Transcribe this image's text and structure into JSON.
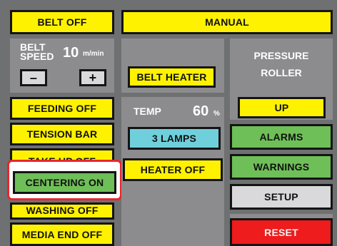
{
  "header": {
    "belt_button": "BELT OFF",
    "mode_button": "MANUAL"
  },
  "belt_speed": {
    "label_line1": "BELT",
    "label_line2": "SPEED",
    "value": "10",
    "unit": "m/min",
    "minus_label": "–",
    "plus_label": "+"
  },
  "left_column": {
    "feeding": "FEEDING OFF",
    "tension_bar": "TENSION BAR",
    "take_up": "TAKE UP OFF",
    "centering": "CENTERING ON",
    "washing": "WASHING OFF",
    "media_end": "MEDIA END OFF"
  },
  "middle_column": {
    "belt_heater": "BELT HEATER",
    "temp_label": "TEMP",
    "temp_value": "60",
    "temp_unit": "%",
    "lamps": "3 LAMPS",
    "heater": "HEATER OFF"
  },
  "right_column": {
    "pressure_line1": "PRESSURE",
    "pressure_line2": "ROLLER",
    "up": "UP",
    "alarms": "ALARMS",
    "warnings": "WARNINGS",
    "setup": "SETUP",
    "reset": "RESET"
  },
  "highlight": {
    "color": "#e8262b",
    "target": "CENTERING ON"
  },
  "colors": {
    "yellow": "#fff200",
    "green": "#6fbf58",
    "cyan": "#6fd0dc",
    "grey": "#d9d9db",
    "red": "#ee1c1c",
    "panel": "#8c8c8e",
    "background": "#6f7072"
  }
}
